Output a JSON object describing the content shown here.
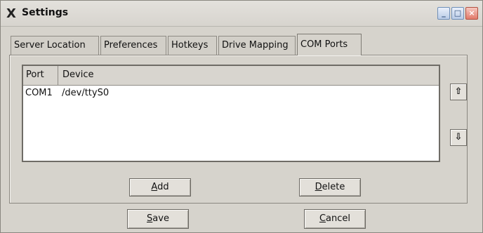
{
  "window": {
    "title": "Settings",
    "app_icon": "X",
    "controls": {
      "minimize": "_",
      "maximize": "□",
      "close": "×"
    }
  },
  "tabs": [
    {
      "label": "Server Location",
      "active": false
    },
    {
      "label": "Preferences",
      "active": false
    },
    {
      "label": "Hotkeys",
      "active": false
    },
    {
      "label": "Drive Mapping",
      "active": false
    },
    {
      "label": "COM Ports",
      "active": true
    }
  ],
  "list": {
    "columns": {
      "port": "Port",
      "device": "Device"
    },
    "rows": [
      {
        "port": "COM1",
        "device": "/dev/ttyS0"
      }
    ]
  },
  "icons": {
    "move_up": "⇧",
    "move_down": "⇩"
  },
  "buttons": {
    "add": {
      "mnemonic": "A",
      "rest": "dd"
    },
    "delete": {
      "mnemonic": "D",
      "rest": "elete"
    },
    "save": {
      "mnemonic": "S",
      "rest": "ave"
    },
    "cancel": {
      "mnemonic": "C",
      "rest": "ancel"
    }
  }
}
